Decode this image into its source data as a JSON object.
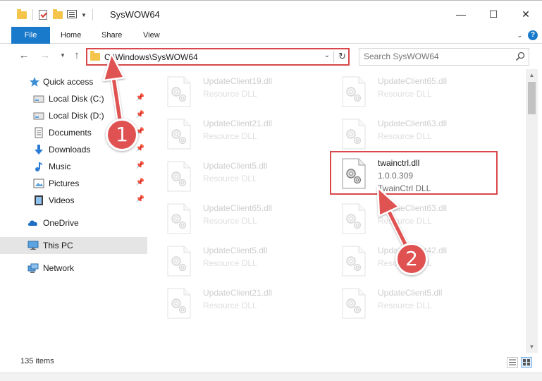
{
  "window": {
    "title": "SysWOW64",
    "minimize": "—",
    "maximize": "☐",
    "close": "✕"
  },
  "ribbon": {
    "tabs": [
      "File",
      "Home",
      "Share",
      "View"
    ],
    "help": "?"
  },
  "address": {
    "path": "C:\\Windows\\SysWOW64"
  },
  "search": {
    "placeholder": "Search SysWOW64"
  },
  "sidebar": {
    "items": [
      {
        "label": "Quick access",
        "icon": "star-icon",
        "pinned": false
      },
      {
        "label": "Local Disk (C:)",
        "icon": "drive-icon",
        "pinned": true
      },
      {
        "label": "Local Disk (D:)",
        "icon": "drive-icon",
        "pinned": true
      },
      {
        "label": "Documents",
        "icon": "documents-icon",
        "pinned": true
      },
      {
        "label": "Downloads",
        "icon": "download-icon",
        "pinned": true
      },
      {
        "label": "Music",
        "icon": "music-icon",
        "pinned": true
      },
      {
        "label": "Pictures",
        "icon": "pictures-icon",
        "pinned": true
      },
      {
        "label": "Videos",
        "icon": "videos-icon",
        "pinned": true
      },
      {
        "label": "OneDrive",
        "icon": "cloud-icon",
        "pinned": false
      },
      {
        "label": "This PC",
        "icon": "monitor-icon",
        "pinned": false,
        "selected": true
      },
      {
        "label": "Network",
        "icon": "network-icon",
        "pinned": false
      }
    ]
  },
  "files": [
    {
      "name": "UpdateClient19.dll",
      "type": "Resource DLL",
      "faded": true
    },
    {
      "name": "UpdateClient65.dll",
      "type": "Resource DLL",
      "faded": true
    },
    {
      "name": "UpdateClient21.dll",
      "type": "Resource DLL",
      "faded": true
    },
    {
      "name": "UpdateClient63.dll",
      "type": "Resource DLL",
      "faded": true
    },
    {
      "name": "UpdateClient5.dll",
      "type": "Resource DLL",
      "faded": true
    },
    {
      "name": "twainctrl.dll",
      "version": "1.0.0.309",
      "type": "TwainCtrl DLL",
      "faded": false,
      "highlight": true
    },
    {
      "name": "UpdateClient65.dll",
      "type": "Resource DLL",
      "faded": true
    },
    {
      "name": "UpdateClient63.dll",
      "type": "Resource DLL",
      "faded": true
    },
    {
      "name": "UpdateClient5.dll",
      "type": "Resource DLL",
      "faded": true
    },
    {
      "name": "UpdateClient42.dll",
      "type": "Resource DLL",
      "faded": true
    },
    {
      "name": "UpdateClient21.dll",
      "type": "Resource DLL",
      "faded": true
    },
    {
      "name": "UpdateClient5.dll",
      "type": "Resource DLL",
      "faded": true
    }
  ],
  "status": {
    "item_count": "135 items"
  },
  "annotations": {
    "step1": "1",
    "step2": "2",
    "color": "#e05252"
  }
}
